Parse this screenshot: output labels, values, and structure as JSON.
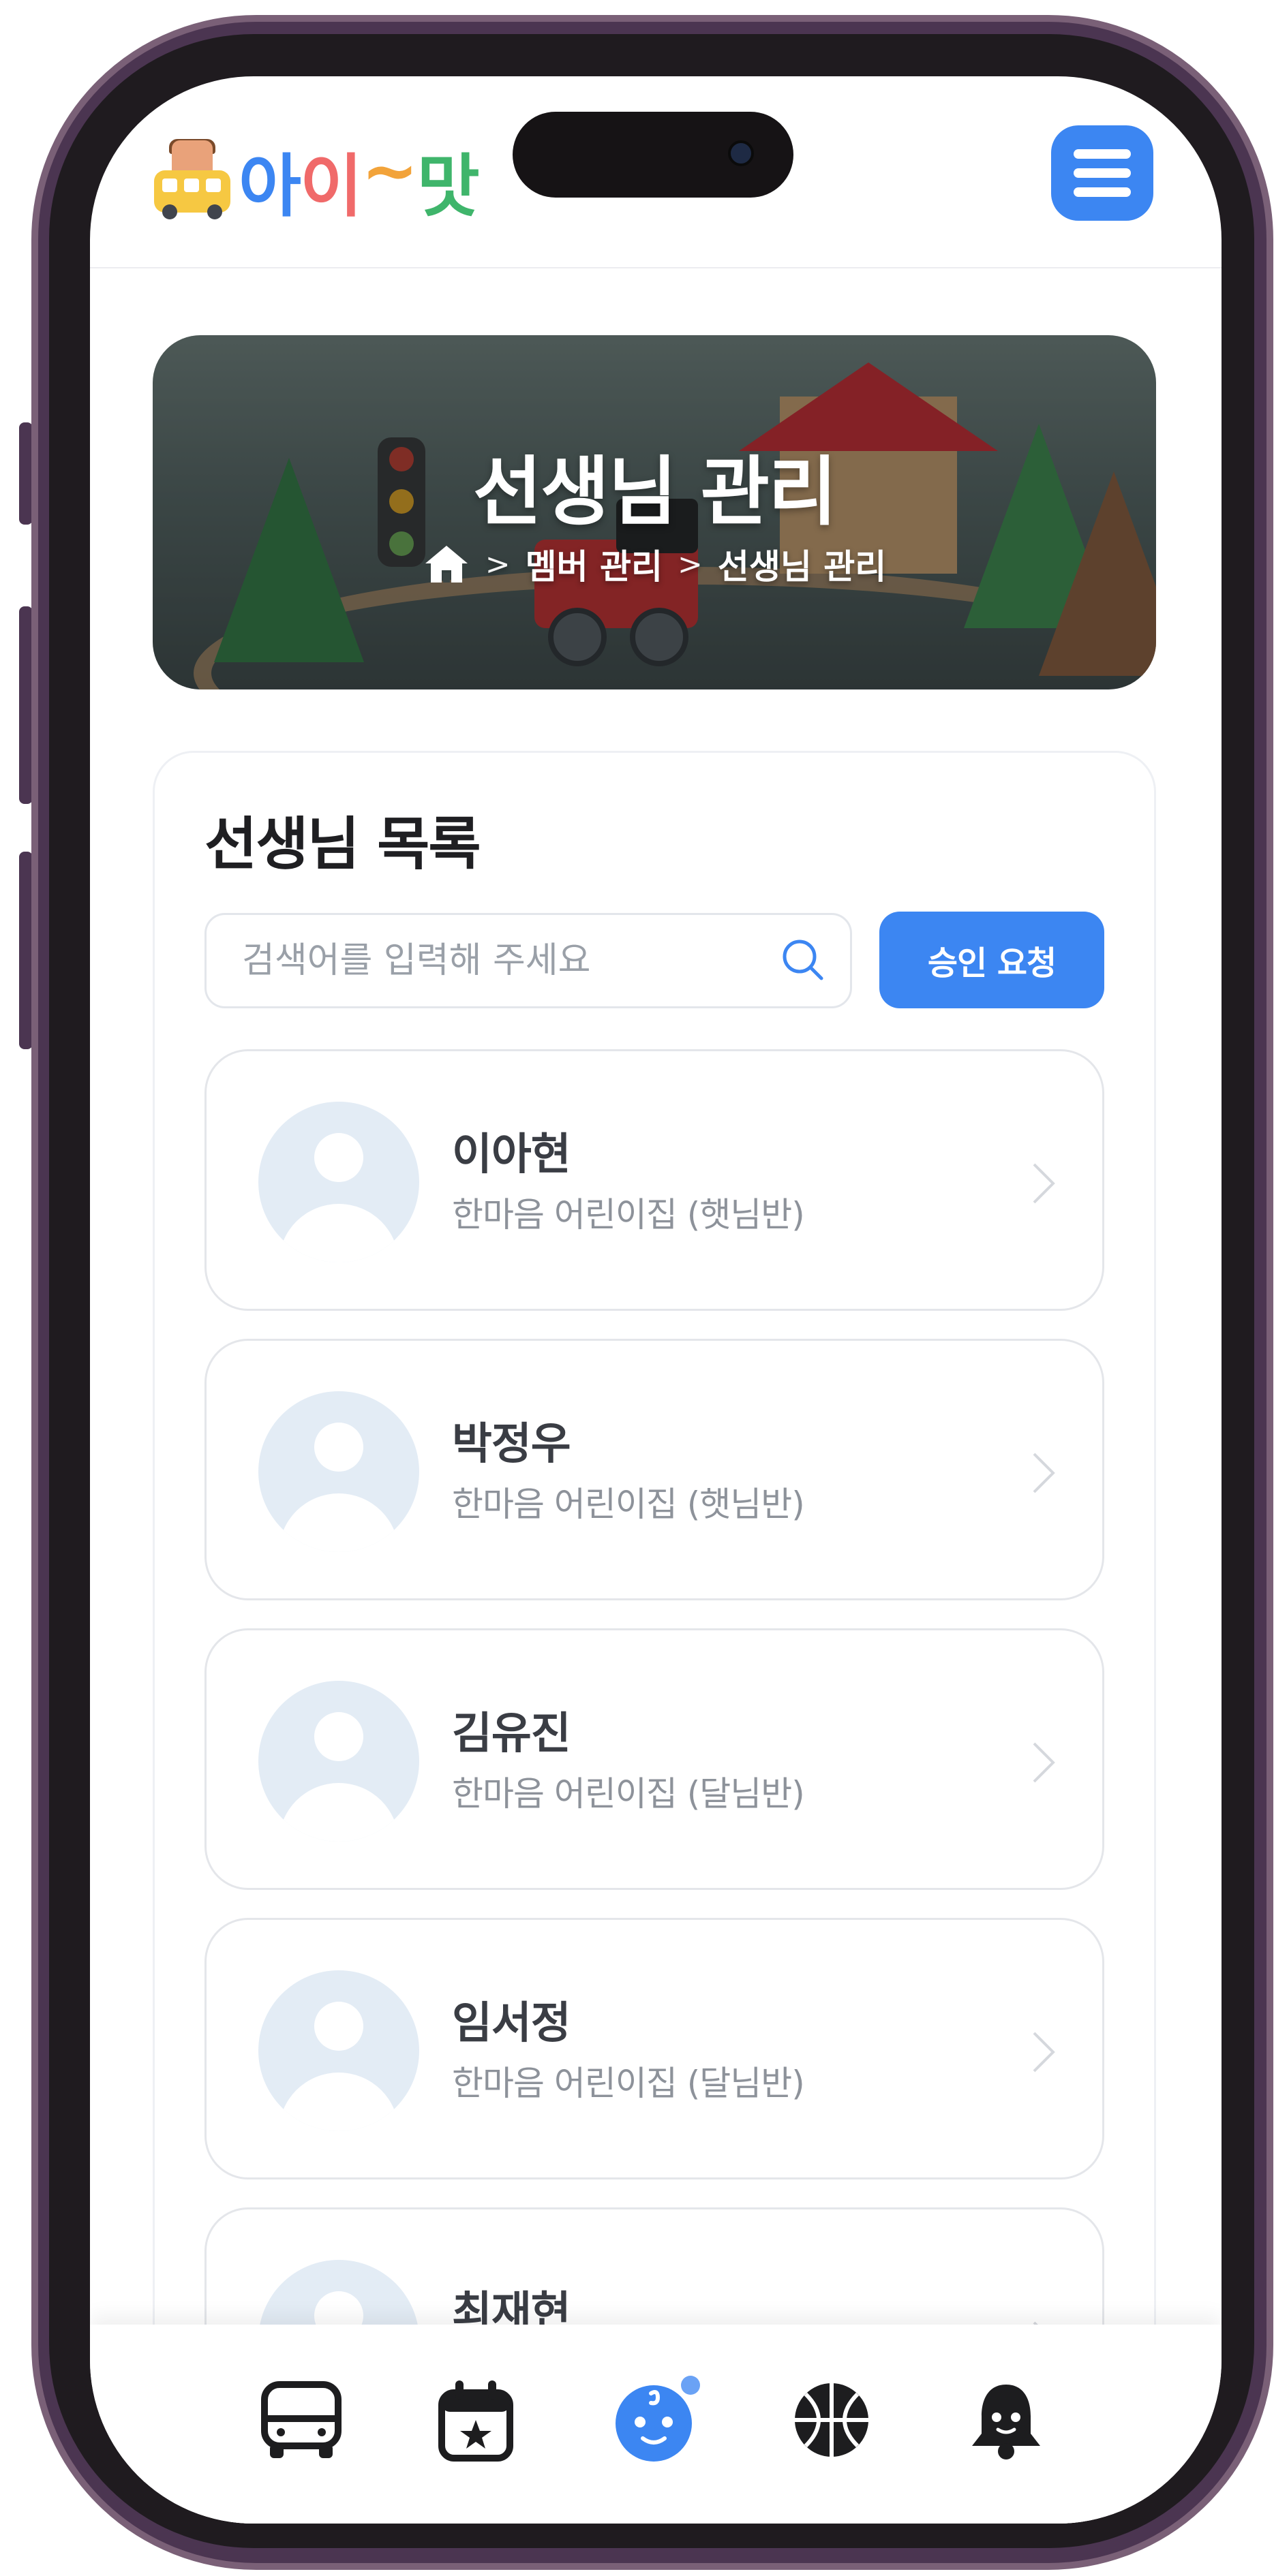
{
  "app": {
    "logo_text": [
      "아",
      "이",
      "~",
      "맛"
    ],
    "logo_colors": [
      "#3c86f2",
      "#f06a6a",
      "#f2a33a",
      "#3fb56b"
    ],
    "accent_color": "#3c86f2"
  },
  "header": {
    "menu_icon": "hamburger-menu-icon"
  },
  "banner": {
    "title": "선생님 관리",
    "breadcrumb": {
      "home_icon": "home-icon",
      "items": [
        "멤버 관리",
        "선생님 관리"
      ],
      "separator": ">"
    }
  },
  "teacher_list": {
    "title": "선생님 목록",
    "search": {
      "placeholder": "검색어를 입력해 주세요",
      "value": "",
      "icon": "search-icon"
    },
    "approve_button": "승인 요청",
    "items": [
      {
        "name": "이아현",
        "org": "한마음 어린이집 (햇님반)"
      },
      {
        "name": "박정우",
        "org": "한마음 어린이집 (햇님반)"
      },
      {
        "name": "김유진",
        "org": "한마음 어린이집 (달님반)"
      },
      {
        "name": "임서정",
        "org": "한마음 어린이집 (달님반)"
      },
      {
        "name": "최재현",
        "org": ""
      }
    ]
  },
  "bottom_nav": {
    "items": [
      {
        "icon": "bus-icon",
        "active": false
      },
      {
        "icon": "calendar-star-icon",
        "active": false
      },
      {
        "icon": "baby-face-icon",
        "active": true,
        "badge": true
      },
      {
        "icon": "basketball-icon",
        "active": false
      },
      {
        "icon": "bell-icon",
        "active": false
      }
    ]
  }
}
